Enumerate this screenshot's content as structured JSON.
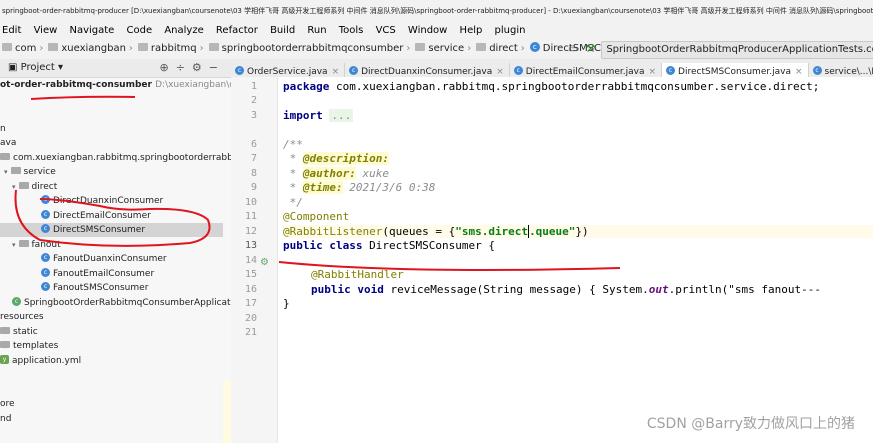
{
  "window": {
    "title": "springboot-order-rabbitmq-producer [D:\\xuexiangban\\coursenote\\03 学相伴飞哥 高级开发工程师系列 中间件 消息队列\\源码\\springboot-order-rabbitmq-producer] - D:\\xuexiangban\\coursenote\\03 学相伴飞哥 高级开发工程师系列 中间件 消息队列\\源码\\springboot-order-rabbitmq-..."
  },
  "menu": [
    "Edit",
    "View",
    "Navigate",
    "Code",
    "Analyze",
    "Refactor",
    "Build",
    "Run",
    "Tools",
    "VCS",
    "Window",
    "Help",
    "plugin"
  ],
  "breadcrumb": [
    {
      "label": "com",
      "icon": "folder"
    },
    {
      "label": "xuexiangban",
      "icon": "folder"
    },
    {
      "label": "rabbitmq",
      "icon": "folder"
    },
    {
      "label": "springbootorderrabbitmqconsumber",
      "icon": "folder"
    },
    {
      "label": "service",
      "icon": "folder"
    },
    {
      "label": "direct",
      "icon": "folder"
    },
    {
      "label": "DirectSMSConsumer",
      "icon": "class"
    }
  ],
  "run_config": "SpringbootOrderRabbitmqProducerApplicationTests.conte",
  "project_panel": {
    "title": "Project",
    "root_name": "ot-order-rabbitmq-consumber",
    "root_path": "D:\\xuexiangban\\cou",
    "tree": [
      {
        "label": "n",
        "icon": "none"
      },
      {
        "label": "ava",
        "icon": "none"
      },
      {
        "label": "com.xuexiangban.rabbitmq.springbootorderrabbitm",
        "icon": "folder"
      },
      {
        "label": "service",
        "icon": "folder",
        "arrow": "v"
      },
      {
        "label": "direct",
        "icon": "folder",
        "arrow": "v"
      },
      {
        "label": "DirectDuanxinConsumer",
        "icon": "class"
      },
      {
        "label": "DirectEmailConsumer",
        "icon": "class"
      },
      {
        "label": "DirectSMSConsumer",
        "icon": "class",
        "selected": true
      },
      {
        "label": "fanout",
        "icon": "folder",
        "arrow": "v"
      },
      {
        "label": "FanoutDuanxinConsumer",
        "icon": "class"
      },
      {
        "label": "FanoutEmailConsumer",
        "icon": "class"
      },
      {
        "label": "FanoutSMSConsumer",
        "icon": "class"
      },
      {
        "label": "SpringbootOrderRabbitmqConsumberApplicatio",
        "icon": "spring"
      },
      {
        "label": "resources",
        "icon": "none"
      },
      {
        "label": "static",
        "icon": "folder"
      },
      {
        "label": "templates",
        "icon": "folder"
      },
      {
        "label": "application.yml",
        "icon": "yml"
      },
      {
        "label": "ore",
        "icon": "none"
      },
      {
        "label": "nd",
        "icon": "none"
      }
    ]
  },
  "tabs": [
    {
      "label": "OrderService.java",
      "active": false
    },
    {
      "label": "DirectDuanxinConsumer.java",
      "active": false
    },
    {
      "label": "DirectEmailConsumer.java",
      "active": false
    },
    {
      "label": "DirectSMSConsumer.java",
      "active": true
    },
    {
      "label": "service\\...\\FanoutSM",
      "active": false
    }
  ],
  "editor": {
    "line_numbers": [
      "1",
      "2",
      "3",
      "6",
      "7",
      "8",
      "9",
      "10",
      "11",
      "12",
      "13",
      "14",
      "15",
      "16",
      "17",
      "20",
      "21"
    ],
    "package_kw": "package",
    "package_name": " com.xuexiangban.rabbitmq.springbootorderrabbitmqconsumber.service.direct;",
    "import_kw": "import",
    "import_fold": "...",
    "javadoc_open": "/**",
    "desc_tag": "@description:",
    "author_tag": "@author:",
    "author_value": " xuke",
    "time_tag": "@time:",
    "time_value": " 2021/3/6 0:38",
    "javadoc_close": " */",
    "component": "@Component",
    "listener_ann": "@RabbitListener",
    "listener_open": "(queues = {",
    "listener_queue_a": "\"sms.direct",
    "listener_queue_b": ".queue\"",
    "listener_close": "})",
    "class_kw1": "public",
    "class_kw2": "class",
    "class_name": " DirectSMSConsumer {",
    "handler_ann": "@RabbitHandler",
    "method_kw1": "public",
    "method_kw2": "void",
    "method_sig": " reviceMessage(String message) { System.",
    "method_out": "out",
    "method_rest": ".println(\"sms fanout---",
    "closing_brace": "}"
  },
  "watermark": "CSDN @Barry致力做风口上的猪"
}
